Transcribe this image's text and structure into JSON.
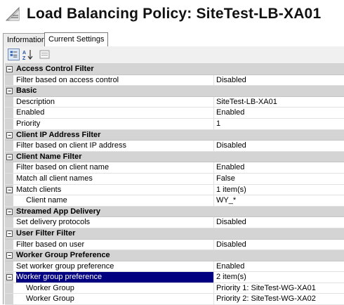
{
  "header": {
    "title": "Load Balancing Policy: SiteTest-LB-XA01",
    "icon": "policy-icon"
  },
  "tabs": [
    {
      "label": "Information",
      "active": false
    },
    {
      "label": "Current Settings",
      "active": true
    }
  ],
  "toolbar": {
    "buttons": [
      "categorized-view-icon",
      "alphabetical-sort-icon",
      "property-pages-icon"
    ]
  },
  "grid": {
    "rows": [
      {
        "type": "category",
        "name": "Access Control Filter"
      },
      {
        "type": "prop",
        "name": "Filter based on access control",
        "value": "Disabled"
      },
      {
        "type": "category",
        "name": "Basic"
      },
      {
        "type": "prop",
        "name": "Description",
        "value": "SiteTest-LB-XA01"
      },
      {
        "type": "prop",
        "name": "Enabled",
        "value": "Enabled"
      },
      {
        "type": "prop",
        "name": "Priority",
        "value": "1"
      },
      {
        "type": "category",
        "name": "Client IP Address Filter"
      },
      {
        "type": "prop",
        "name": "Filter based on client IP address",
        "value": "Disabled"
      },
      {
        "type": "category",
        "name": "Client Name Filter"
      },
      {
        "type": "prop",
        "name": "Filter based on client name",
        "value": "Enabled"
      },
      {
        "type": "prop",
        "name": "Match all client names",
        "value": "False"
      },
      {
        "type": "prop-expand",
        "name": "Match clients",
        "value": "1 item(s)"
      },
      {
        "type": "sub",
        "name": "Client name",
        "value": "WY_*"
      },
      {
        "type": "category",
        "name": "Streamed App Delivery"
      },
      {
        "type": "prop",
        "name": "Set delivery protocols",
        "value": "Disabled"
      },
      {
        "type": "category",
        "name": "User Filter Filter"
      },
      {
        "type": "prop",
        "name": "Filter based on user",
        "value": "Disabled"
      },
      {
        "type": "category",
        "name": "Worker Group Preference"
      },
      {
        "type": "prop",
        "name": "Set worker group preference",
        "value": "Enabled"
      },
      {
        "type": "prop-expand",
        "name": "Worker group preference",
        "value": "2 item(s)",
        "selected": true
      },
      {
        "type": "sub",
        "name": "Worker Group",
        "value": "Priority 1: SiteTest-WG-XA01"
      },
      {
        "type": "sub",
        "name": "Worker Group",
        "value": "Priority 2: SiteTest-WG-XA02"
      }
    ]
  },
  "colors": {
    "selection": "#000080",
    "category_bg": "#d4d4d4"
  }
}
